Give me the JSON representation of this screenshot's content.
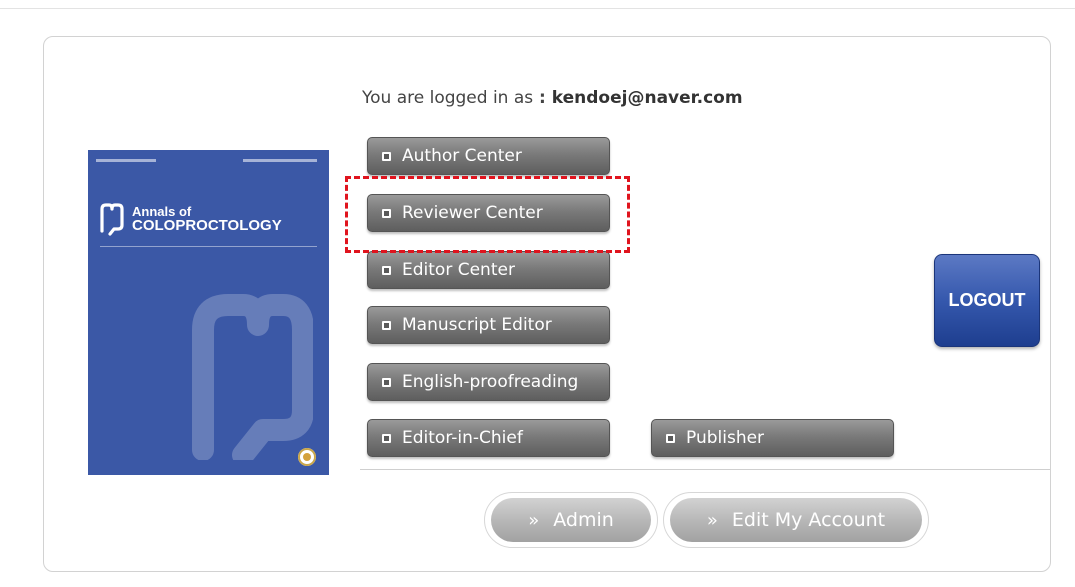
{
  "login": {
    "prefix": "You are logged in as",
    "separator": " : ",
    "email": "kendoej@naver.com"
  },
  "cover": {
    "title_line1": "Annals of",
    "title_line2": "COLOPROCTOLOGY"
  },
  "menu": {
    "author_center": "Author Center",
    "reviewer_center": "Reviewer Center",
    "editor_center": "Editor Center",
    "manuscript_editor": "Manuscript Editor",
    "english_proofreading": "English-proofreading",
    "editor_in_chief": "Editor-in-Chief",
    "publisher": "Publisher"
  },
  "logout_label": "LOGOUT",
  "bottom": {
    "chevron": "»",
    "admin_label": "Admin",
    "edit_account_label": "Edit My Account"
  },
  "colors": {
    "highlight": "#e0141e",
    "cover_blue": "#3b58a6",
    "logout_blue": "#3558ad"
  }
}
